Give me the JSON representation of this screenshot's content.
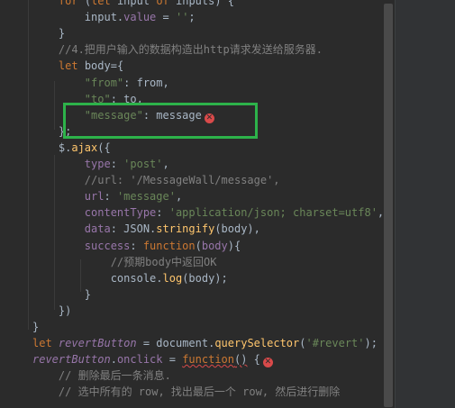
{
  "editor": {
    "lines": [
      [
        {
          "t": "    ",
          "c": ""
        },
        {
          "t": "for",
          "c": "kw"
        },
        {
          "t": " (",
          "c": ""
        },
        {
          "t": "let",
          "c": "kw"
        },
        {
          "t": " input ",
          "c": ""
        },
        {
          "t": "of",
          "c": "kw"
        },
        {
          "t": " inputs) {",
          "c": ""
        }
      ],
      [
        {
          "t": "        input.",
          "c": ""
        },
        {
          "t": "value",
          "c": "prop"
        },
        {
          "t": " = ",
          "c": ""
        },
        {
          "t": "''",
          "c": "str"
        },
        {
          "t": ";",
          "c": ""
        }
      ],
      [
        {
          "t": "    }",
          "c": ""
        }
      ],
      [
        {
          "t": "    //4.把用户输入的数据构造出http请求发送给服务器.",
          "c": "cm"
        }
      ],
      [
        {
          "t": "    ",
          "c": ""
        },
        {
          "t": "let",
          "c": "kw"
        },
        {
          "t": " body={",
          "c": ""
        }
      ],
      [
        {
          "t": "        ",
          "c": ""
        },
        {
          "t": "\"from\"",
          "c": "str"
        },
        {
          "t": ": from,",
          "c": ""
        }
      ],
      [
        {
          "t": "        ",
          "c": ""
        },
        {
          "t": "\"to\"",
          "c": "str"
        },
        {
          "t": ": to,",
          "c": ""
        }
      ],
      [
        {
          "t": "        ",
          "c": ""
        },
        {
          "t": "\"message\"",
          "c": "str"
        },
        {
          "t": ": message",
          "c": ""
        },
        {
          "t": "",
          "c": "err"
        }
      ],
      [
        {
          "t": "    };",
          "c": ""
        }
      ],
      [
        {
          "t": "    $.",
          "c": ""
        },
        {
          "t": "ajax",
          "c": "fn"
        },
        {
          "t": "({",
          "c": ""
        }
      ],
      [
        {
          "t": "        ",
          "c": ""
        },
        {
          "t": "type",
          "c": "prop"
        },
        {
          "t": ": ",
          "c": ""
        },
        {
          "t": "'post'",
          "c": "str"
        },
        {
          "t": ",",
          "c": ""
        }
      ],
      [
        {
          "t": "        //url: '/MessageWall/message',",
          "c": "cm"
        }
      ],
      [
        {
          "t": "        ",
          "c": ""
        },
        {
          "t": "url",
          "c": "prop"
        },
        {
          "t": ": ",
          "c": ""
        },
        {
          "t": "'message'",
          "c": "str"
        },
        {
          "t": ",",
          "c": ""
        }
      ],
      [
        {
          "t": "        ",
          "c": ""
        },
        {
          "t": "contentType",
          "c": "prop"
        },
        {
          "t": ": ",
          "c": ""
        },
        {
          "t": "'application/json; charset=utf8'",
          "c": "str"
        },
        {
          "t": ",",
          "c": ""
        }
      ],
      [
        {
          "t": "        ",
          "c": ""
        },
        {
          "t": "data",
          "c": "prop"
        },
        {
          "t": ": JSON.",
          "c": ""
        },
        {
          "t": "stringify",
          "c": "fn"
        },
        {
          "t": "(body),",
          "c": ""
        }
      ],
      [
        {
          "t": "        ",
          "c": ""
        },
        {
          "t": "success",
          "c": "prop"
        },
        {
          "t": ": ",
          "c": ""
        },
        {
          "t": "function",
          "c": "kw"
        },
        {
          "t": "(",
          "c": ""
        },
        {
          "t": "body",
          "c": "prop"
        },
        {
          "t": "){",
          "c": ""
        }
      ],
      [
        {
          "t": "            //预期body中返回OK",
          "c": "cm"
        }
      ],
      [
        {
          "t": "            console.",
          "c": ""
        },
        {
          "t": "log",
          "c": "fn"
        },
        {
          "t": "(body);",
          "c": ""
        }
      ],
      [
        {
          "t": "        }",
          "c": ""
        }
      ],
      [
        {
          "t": "    })",
          "c": ""
        }
      ],
      [
        {
          "t": "}",
          "c": ""
        }
      ],
      [
        {
          "t": "let",
          "c": "kw"
        },
        {
          "t": " ",
          "c": ""
        },
        {
          "t": "revertButton",
          "c": "prop italic"
        },
        {
          "t": " = document.",
          "c": ""
        },
        {
          "t": "querySelector",
          "c": "fn"
        },
        {
          "t": "(",
          "c": ""
        },
        {
          "t": "'#revert'",
          "c": "str"
        },
        {
          "t": ");",
          "c": ""
        }
      ],
      [
        {
          "t": "revertButton",
          "c": "prop italic"
        },
        {
          "t": ".",
          "c": ""
        },
        {
          "t": "onclick",
          "c": "prop"
        },
        {
          "t": " = ",
          "c": ""
        },
        {
          "t": "function",
          "c": "kw squiggle"
        },
        {
          "t": "()",
          "c": "squiggle"
        },
        {
          "t": " {",
          "c": ""
        },
        {
          "t": "",
          "c": "err"
        }
      ],
      [
        {
          "t": "    // 删除最后一条消息.",
          "c": "cm"
        }
      ],
      [
        {
          "t": "    // 选中所有的 row, 找出最后一个 row, 然后进行删除",
          "c": "cm"
        }
      ]
    ]
  },
  "error_icon_glyph": "✕",
  "colors": {
    "background": "#2b2b2b",
    "keyword": "#cc7832",
    "string": "#6a8759",
    "comment": "#808080",
    "property": "#9876aa",
    "function": "#ffc66d",
    "text": "#a9b7c6",
    "error": "#d94a4a",
    "highlight_box": "#2db24a"
  }
}
